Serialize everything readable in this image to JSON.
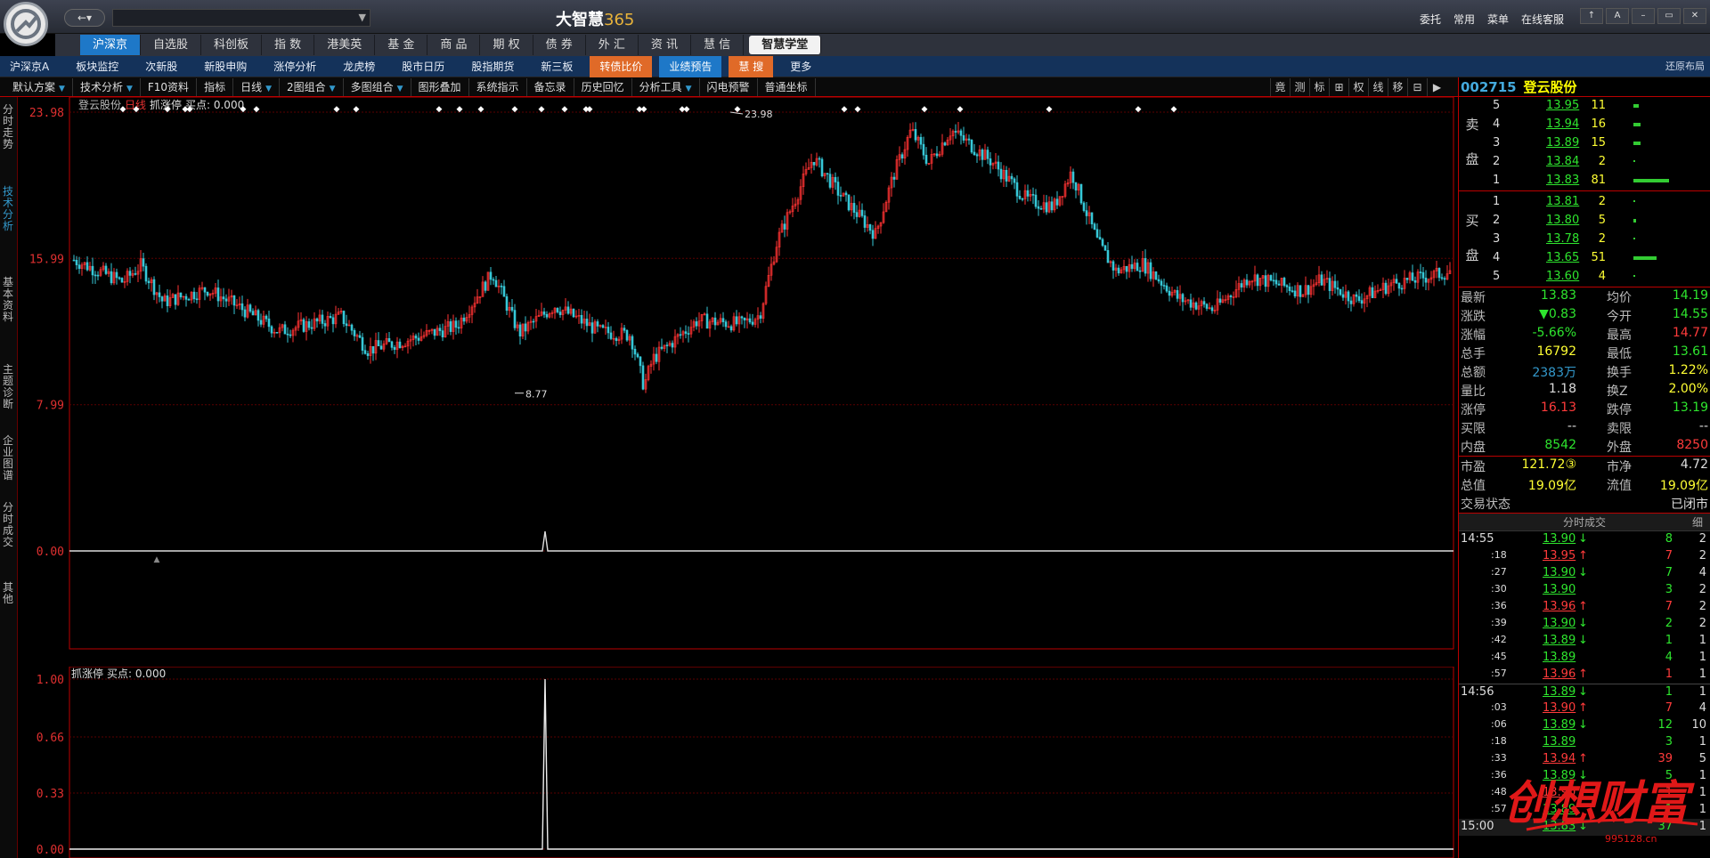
{
  "app": {
    "brand": "大智慧",
    "brand_num": "365",
    "nav": "←▾"
  },
  "topright": [
    "委托",
    "常用",
    "菜单",
    "在线客服"
  ],
  "winbtns": [
    "↑",
    "A",
    "–",
    "▭",
    "✕"
  ],
  "menu": [
    "沪深京",
    "自选股",
    "科创板",
    "指 数",
    "港美英",
    "基 金",
    "商 品",
    "期 权",
    "债 券",
    "外 汇",
    "资 讯",
    "慧 信",
    "智慧学堂"
  ],
  "subnav": [
    "沪深京A",
    "板块监控",
    "次新股",
    "新股申购",
    "涨停分析",
    "龙虎榜",
    "股市日历",
    "股指期货",
    "新三板",
    "转债比价",
    "业绩预告",
    "慧 搜",
    "更多"
  ],
  "restore": "还原布局",
  "toolbar": [
    "默认方案",
    "技术分析",
    "F10资料",
    "指标",
    "日线",
    "2图组合",
    "多图组合",
    "图形叠加",
    "系统指示",
    "备忘录",
    "历史回忆",
    "分析工具",
    "闪电预警",
    "普通坐标"
  ],
  "rtools": [
    "竟",
    "测",
    "标",
    "⊞",
    "权",
    "线",
    "移",
    "⊟",
    "▶"
  ],
  "lefttabs": [
    "分时走势",
    "技术分析",
    "基本资料",
    "主题诊断",
    "企业图谱",
    "分时成交",
    "其他"
  ],
  "chart": {
    "title": "登云股份",
    "period": "日线",
    "indicator": "抓涨停",
    "buy_label": "买点: 0.000",
    "y_labels": [
      "23.98",
      "15.99",
      "7.99",
      "0.00"
    ],
    "high_label": "23.98",
    "low_label": "8.77",
    "sub_title": "抓涨停",
    "sub_buy": "买点: 0.000",
    "sub_y_labels": [
      "1.00",
      "0.66",
      "0.33",
      "0.00"
    ]
  },
  "chart_data": {
    "type": "candlestick",
    "ylim": [
      0,
      23.98
    ],
    "y_ticks": [
      23.98,
      15.99,
      7.99,
      0.0
    ],
    "annotations": {
      "high": 23.98,
      "low": 8.77
    },
    "sub": {
      "type": "line",
      "ylim": [
        0,
        1.0
      ],
      "y_ticks": [
        1.0,
        0.66,
        0.33,
        0.0
      ]
    }
  },
  "quote": {
    "code": "002715",
    "name": "登云股份",
    "sell_label": "卖 盘",
    "buy_label": "买 盘",
    "sell": [
      {
        "lvl": "5",
        "price": "13.95",
        "vol": "11"
      },
      {
        "lvl": "4",
        "price": "13.94",
        "vol": "16"
      },
      {
        "lvl": "3",
        "price": "13.89",
        "vol": "15"
      },
      {
        "lvl": "2",
        "price": "13.84",
        "vol": "2"
      },
      {
        "lvl": "1",
        "price": "13.83",
        "vol": "81"
      }
    ],
    "buy": [
      {
        "lvl": "1",
        "price": "13.81",
        "vol": "2"
      },
      {
        "lvl": "2",
        "price": "13.80",
        "vol": "5"
      },
      {
        "lvl": "3",
        "price": "13.78",
        "vol": "2"
      },
      {
        "lvl": "4",
        "price": "13.65",
        "vol": "51"
      },
      {
        "lvl": "5",
        "price": "13.60",
        "vol": "4"
      }
    ],
    "fields": [
      {
        "l": "最新",
        "v": "13.83",
        "l2": "均价",
        "v2": "14.19"
      },
      {
        "l": "涨跌",
        "v": "▼0.83",
        "l2": "今开",
        "v2": "14.55"
      },
      {
        "l": "涨幅",
        "v": "-5.66%",
        "l2": "最高",
        "v2": "14.77"
      },
      {
        "l": "总手",
        "v": "16792",
        "l2": "最低",
        "v2": "13.61"
      },
      {
        "l": "总额",
        "v": "2383万",
        "l2": "换手",
        "v2": "1.22%"
      },
      {
        "l": "量比",
        "v": "1.18",
        "l2": "换Z",
        "v2": "2.00%"
      },
      {
        "l": "涨停",
        "v": "16.13",
        "l2": "跌停",
        "v2": "13.19"
      },
      {
        "l": "买限",
        "v": "--",
        "l2": "卖限",
        "v2": "--"
      },
      {
        "l": "内盘",
        "v": "8542",
        "l2": "外盘",
        "v2": "8250"
      }
    ],
    "fields2": [
      {
        "l": "市盈",
        "v": "121.72③",
        "l2": "市净",
        "v2": "4.72"
      },
      {
        "l": "总值",
        "v": "19.09亿",
        "l2": "流值",
        "v2": "19.09亿"
      },
      {
        "l": "交易状态",
        "v": "",
        "l2": "",
        "v2": "已闭市"
      }
    ],
    "trades_title": "分时成交",
    "trades_col": "细",
    "trades": [
      {
        "t": "14:55",
        "p": "13.90",
        "d": "↓",
        "v": "8",
        "n": "2"
      },
      {
        "t": ":18",
        "p": "13.95",
        "d": "↑",
        "v": "7",
        "n": "2"
      },
      {
        "t": ":27",
        "p": "13.90",
        "d": "↓",
        "v": "7",
        "n": "4"
      },
      {
        "t": ":30",
        "p": "13.90",
        "d": "",
        "v": "3",
        "n": "2"
      },
      {
        "t": ":36",
        "p": "13.96",
        "d": "↑",
        "v": "7",
        "n": "2"
      },
      {
        "t": ":39",
        "p": "13.90",
        "d": "↓",
        "v": "2",
        "n": "2"
      },
      {
        "t": ":42",
        "p": "13.89",
        "d": "↓",
        "v": "1",
        "n": "1"
      },
      {
        "t": ":45",
        "p": "13.89",
        "d": "",
        "v": "4",
        "n": "1"
      },
      {
        "t": ":57",
        "p": "13.96",
        "d": "↑",
        "v": "1",
        "n": "1"
      },
      {
        "t": "14:56",
        "p": "13.89",
        "d": "↓",
        "v": "1",
        "n": "1"
      },
      {
        "t": ":03",
        "p": "13.90",
        "d": "↑",
        "v": "7",
        "n": "4"
      },
      {
        "t": ":06",
        "p": "13.89",
        "d": "↓",
        "v": "12",
        "n": "10"
      },
      {
        "t": ":18",
        "p": "13.89",
        "d": "",
        "v": "3",
        "n": "1"
      },
      {
        "t": ":33",
        "p": "13.94",
        "d": "↑",
        "v": "39",
        "n": "5"
      },
      {
        "t": ":36",
        "p": "13.89",
        "d": "↓",
        "v": "5",
        "n": "1"
      },
      {
        "t": ":48",
        "p": "13.90",
        "d": "↑",
        "v": "1",
        "n": "1"
      },
      {
        "t": ":57",
        "p": "13.89",
        "d": "",
        "v": "1",
        "n": "1"
      },
      {
        "t": "15:00",
        "p": "13.83",
        "d": "↓",
        "v": "37",
        "n": "1"
      }
    ]
  },
  "watermark": {
    "text": "创想财富",
    "url": "995128.cn"
  }
}
